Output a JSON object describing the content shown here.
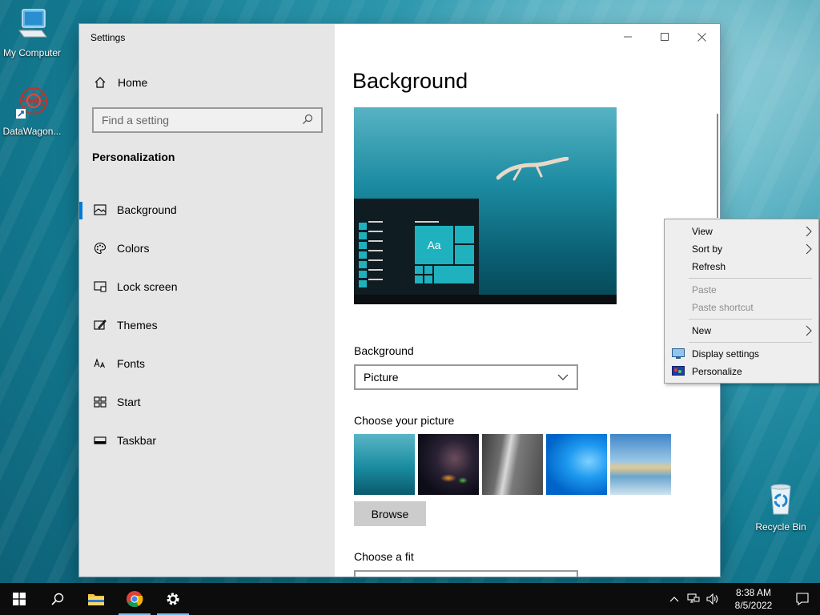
{
  "desktop": {
    "icons": [
      {
        "label": "My Computer"
      },
      {
        "label": "DataWagon..."
      },
      {
        "label": "Recycle Bin"
      }
    ]
  },
  "window": {
    "title": "Settings",
    "sidebar": {
      "home_label": "Home",
      "search_placeholder": "Find a setting",
      "section_heading": "Personalization",
      "items": [
        {
          "label": "Background",
          "icon": "picture-icon",
          "active": true
        },
        {
          "label": "Colors",
          "icon": "palette-icon"
        },
        {
          "label": "Lock screen",
          "icon": "lock-screen-icon"
        },
        {
          "label": "Themes",
          "icon": "themes-icon"
        },
        {
          "label": "Fonts",
          "icon": "fonts-icon"
        },
        {
          "label": "Start",
          "icon": "start-icon"
        },
        {
          "label": "Taskbar",
          "icon": "taskbar-icon"
        }
      ]
    },
    "content": {
      "page_title": "Background",
      "preview_tile_text": "Aa",
      "background_label": "Background",
      "background_value": "Picture",
      "choose_picture_label": "Choose your picture",
      "browse_label": "Browse",
      "choose_fit_label": "Choose a fit"
    }
  },
  "context_menu": {
    "items": [
      {
        "label": "View",
        "submenu": true
      },
      {
        "label": "Sort by",
        "submenu": true
      },
      {
        "label": "Refresh"
      },
      {
        "label": "Paste",
        "disabled": true
      },
      {
        "label": "Paste shortcut",
        "disabled": true
      },
      {
        "label": "New",
        "submenu": true
      },
      {
        "label": "Display settings",
        "icon": "display-icon"
      },
      {
        "label": "Personalize",
        "icon": "personalize-icon"
      }
    ]
  },
  "taskbar": {
    "time": "8:38 AM",
    "date": "8/5/2022"
  },
  "colors": {
    "accent": "#0078d7",
    "sidebar_bg": "#e6e6e6",
    "taskbar_bg": "#0c0c0c"
  }
}
